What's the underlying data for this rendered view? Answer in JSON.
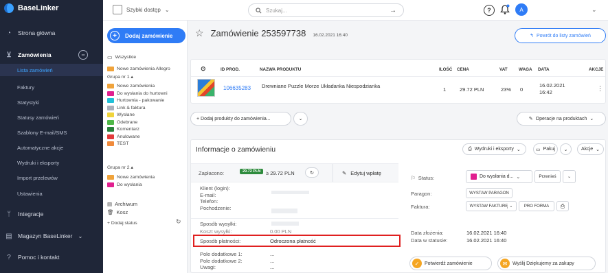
{
  "brand": "BaseLinker",
  "sidebar": {
    "items": [
      {
        "icon": "dashboard-icon",
        "glyph": "◔",
        "label": "Strona główna"
      },
      {
        "icon": "cart-icon",
        "glyph": "⊻",
        "label": "Zamówienia"
      },
      {
        "icon": "plug-icon",
        "glyph": "ᛘ",
        "label": "Integracje"
      },
      {
        "icon": "storage-icon",
        "glyph": "▤",
        "label": "Magazyn BaseLinker",
        "chevron": "⌄"
      },
      {
        "icon": "help-icon",
        "glyph": "?",
        "label": "Pomoc i kontakt"
      }
    ],
    "orders_sub": [
      "Lista zamówień",
      "Faktury",
      "Statystyki",
      "Statusy zamówień",
      "Szablony E-mail/SMS",
      "Automatyczne akcje",
      "Wydruki i eksporty",
      "Import przelewów",
      "Ustawienia"
    ],
    "collapse": "−"
  },
  "topbar": {
    "quick_access": "Szybki dostęp",
    "quick_chevron": "⌄",
    "search_placeholder": "Szukaj...",
    "search_arrow": "→",
    "help": "?",
    "avatar": "A",
    "chevron": "⌄"
  },
  "statuses": {
    "add_order": "Dodaj zamówienie",
    "all": "Wszystkie",
    "allegro": "Nowe zamówienia Allegro",
    "group1": "Grupa nr 1 ▴",
    "group1_items": [
      {
        "label": "Nowe zamówienia",
        "color": "#f0a33b"
      },
      {
        "label": "Do wysłania do hurtowni",
        "color": "#e11f8f"
      },
      {
        "label": "Hurtownia - pakowanie",
        "color": "#21c0d8"
      },
      {
        "label": "Link & faktura",
        "color": "#aab0bb"
      },
      {
        "label": "Wysłane",
        "color": "#f0d43b"
      },
      {
        "label": "Odebrane",
        "color": "#4fb848"
      },
      {
        "label": "Komentarz",
        "color": "#27823a"
      },
      {
        "label": "Anulowane",
        "color": "#e33b3b"
      },
      {
        "label": "TEST",
        "color": "#f08a3b"
      }
    ],
    "group2": "Grupa nr 2 ▴",
    "group2_items": [
      {
        "label": "Nowe zamówienia",
        "color": "#f0a33b"
      },
      {
        "label": "Do wysłania",
        "color": "#e11f8f"
      }
    ],
    "archive": "Archiwum",
    "trash": "Kosz",
    "add_status": "+ Dodaj status"
  },
  "order": {
    "title": "Zamówienie 253597738",
    "date": "16.02.2021 16:40",
    "back": "Powrót do listy zamówień",
    "table_headers": {
      "id": "ID PROD.",
      "name": "NAZWA PRODUKTU",
      "qty": "ILOŚĆ",
      "price": "CENA",
      "vat": "VAT",
      "weight": "WAGA",
      "date": "DATA",
      "actions": "AKCJE"
    },
    "product": {
      "id": "106635283",
      "name": "Drewniane Puzzle Morze Układanka Niespodzianka",
      "qty": "1",
      "price": "29.72 PLN",
      "vat": "23%",
      "weight": "0",
      "date1": "16.02.2021",
      "date2": "16:42",
      "menu": "⋮"
    },
    "add_products": "+ Dodaj produkty do zamówienia...",
    "ops": "Operacje na produktach",
    "info_title": "Informacje o zamówieniu",
    "prints": "Wydruki i eksporty",
    "pack": "Pakuj",
    "actions": "Akcje",
    "paid_label": "Zapłacono:",
    "paid_badge": "29.72 PLN",
    "paid_value": "≥ 29.72 PLN",
    "edit_payment": "Edytuj wpłatę",
    "client_labels": [
      "Klient (login):",
      "E-mail:",
      "Telefon:",
      "Pochodzenie:"
    ],
    "shipping_label": "Sposób wysyłki:",
    "shipping_cost_label": "Koszt wysyłki:",
    "shipping_cost": "0.00 PLN",
    "payment_label": "Sposób płatności:",
    "payment_value": "Odroczona płatność",
    "extra_labels": [
      "Pole dodatkowe 1:",
      "Pole dodatkowe 2:",
      "Uwagi:"
    ],
    "extra_values": [
      "...",
      "...",
      "..."
    ],
    "status_label": "Status:",
    "status_value": "Do wysłania d...",
    "status_color": "#e11f8f",
    "move": "Przenieś",
    "receipt_label": "Paragon:",
    "receipt_btn": "WYSTAW PARAGON",
    "invoice_label": "Faktura:",
    "invoice_btn": "WYSTAW FAKTURĘ",
    "proforma_btn": "PRO FORMA",
    "created_label": "Data złożenia:",
    "created_value": "16.02.2021 16:40",
    "status_date_label": "Data w statusie:",
    "status_date_value": "16.02.2021 16:40",
    "confirm": "Potwierdź zamówienie",
    "send_thanks": "Wyślij Dziękujemy za zakupy"
  },
  "colors": {
    "accent": "#2f7cf6",
    "sidebar": "#1f2638",
    "highlight": "#e02020",
    "paid": "#2e8b3d",
    "confirm": "#f5a623"
  }
}
